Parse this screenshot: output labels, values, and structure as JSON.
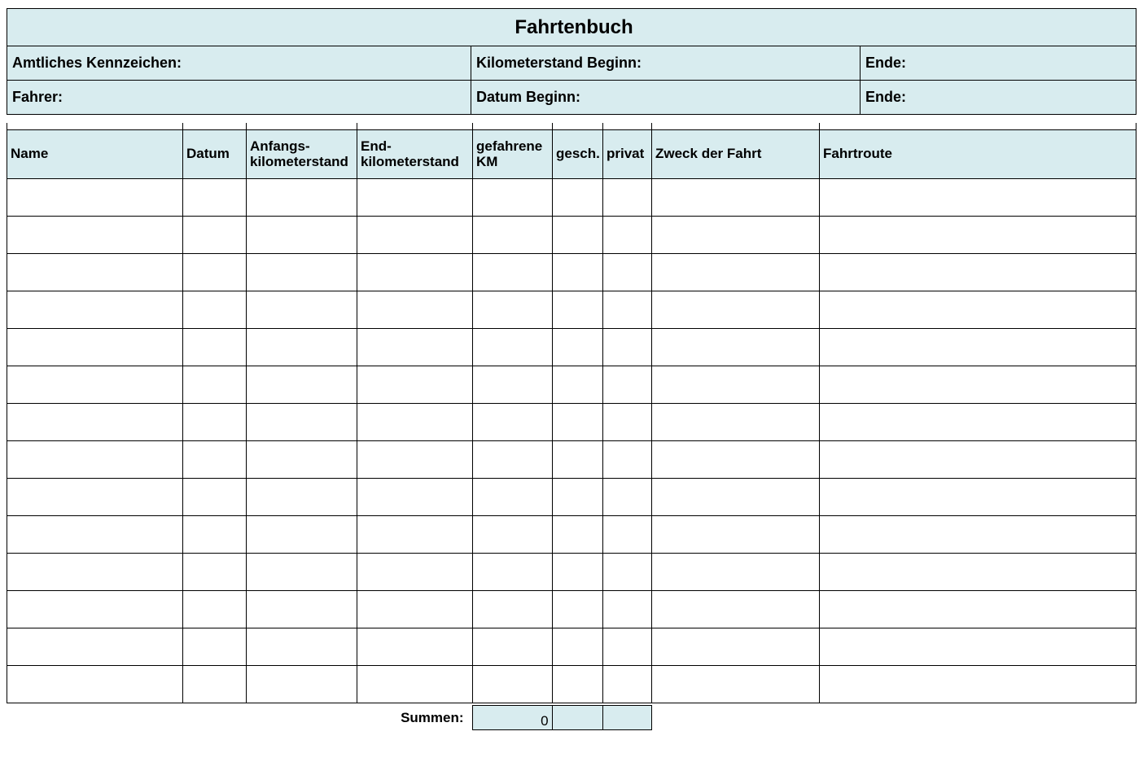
{
  "title": "Fahrtenbuch",
  "meta": {
    "license": "Amtliches Kennzeichen:",
    "km_begin": "Kilometerstand Beginn:",
    "km_end": "Ende:",
    "driver": "Fahrer:",
    "date_begin": "Datum Beginn:",
    "date_end": "Ende:"
  },
  "columns": {
    "name": "Name",
    "date": "Datum",
    "start_km": "Anfangs-kilometerstand",
    "end_km": "End-kilometerstand",
    "driven_km": "gefahrene KM",
    "business": "gesch.",
    "private": "privat",
    "purpose": "Zweck der Fahrt",
    "route": "Fahrtroute"
  },
  "row_count": 14,
  "summary": {
    "label": "Summen:",
    "km_total": "0",
    "business_total": "",
    "private_total": ""
  }
}
